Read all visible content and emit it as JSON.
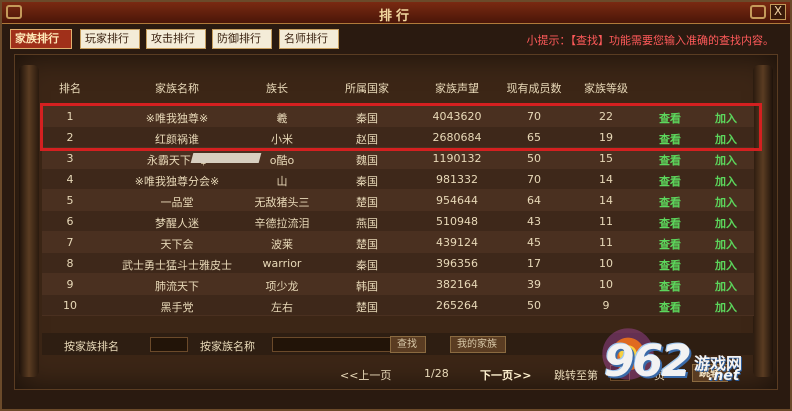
{
  "window": {
    "title": "排行",
    "close_label": "X"
  },
  "tabs": [
    {
      "label": "家族排行",
      "active": true
    },
    {
      "label": "玩家排行",
      "active": false
    },
    {
      "label": "攻击排行",
      "active": false
    },
    {
      "label": "防御排行",
      "active": false
    },
    {
      "label": "名师排行",
      "active": false
    }
  ],
  "hint": "小提示：【查找】功能需要您输入准确的查找内容。",
  "table": {
    "headers": [
      "排名",
      "家族名称",
      "族长",
      "所属国家",
      "家族声望",
      "现有成员数",
      "家族等级"
    ],
    "view_label": "查看",
    "join_label": "加入",
    "rows": [
      {
        "rank": "1",
        "name": "※唯我独尊※",
        "leader": "羲",
        "country": "秦国",
        "prestige": "4043620",
        "members": "70",
        "level": "22"
      },
      {
        "rank": "2",
        "name": "红颜祸谁",
        "leader": "小米",
        "country": "赵国",
        "prestige": "2680684",
        "members": "65",
        "level": "19"
      },
      {
        "rank": "3",
        "name": "永霸天下~$",
        "leader": "o酷o",
        "country": "魏国",
        "prestige": "1190132",
        "members": "50",
        "level": "15"
      },
      {
        "rank": "4",
        "name": "※唯我独尊分会※",
        "leader": "山",
        "country": "秦国",
        "prestige": "981332",
        "members": "70",
        "level": "14"
      },
      {
        "rank": "5",
        "name": "一品堂",
        "leader": "无敌猪头三",
        "country": "楚国",
        "prestige": "954644",
        "members": "64",
        "level": "14"
      },
      {
        "rank": "6",
        "name": "梦醒人迷",
        "leader": "辛德拉流泪",
        "country": "燕国",
        "prestige": "510948",
        "members": "43",
        "level": "11"
      },
      {
        "rank": "7",
        "name": "天下会",
        "leader": "波莱",
        "country": "楚国",
        "prestige": "439124",
        "members": "45",
        "level": "11"
      },
      {
        "rank": "8",
        "name": "武士勇士猛斗士雅皮士",
        "leader": "warrior",
        "country": "秦国",
        "prestige": "396356",
        "members": "17",
        "level": "10"
      },
      {
        "rank": "9",
        "name": "肺流天下",
        "leader": "项少龙",
        "country": "韩国",
        "prestige": "382164",
        "members": "39",
        "level": "10"
      },
      {
        "rank": "10",
        "name": "黑手党",
        "leader": "左右",
        "country": "楚国",
        "prestige": "265264",
        "members": "50",
        "level": "9"
      }
    ]
  },
  "search": {
    "rank_label": "按家族排名",
    "name_label": "按家族名称",
    "find_button": "查找",
    "my_family_button": "我的家族"
  },
  "pager": {
    "prev": "<<上一页",
    "page": "1/28",
    "next": "下一页>>",
    "jump_label": "跳转至第",
    "page_suffix": "页",
    "go_button": "跳转"
  },
  "watermark": {
    "number": "962",
    "site": "游戏网",
    "net": ".net"
  },
  "colors": {
    "accent_red": "#d42020",
    "action_green": "#5cd65c",
    "hint_red": "#ff5a5a"
  }
}
